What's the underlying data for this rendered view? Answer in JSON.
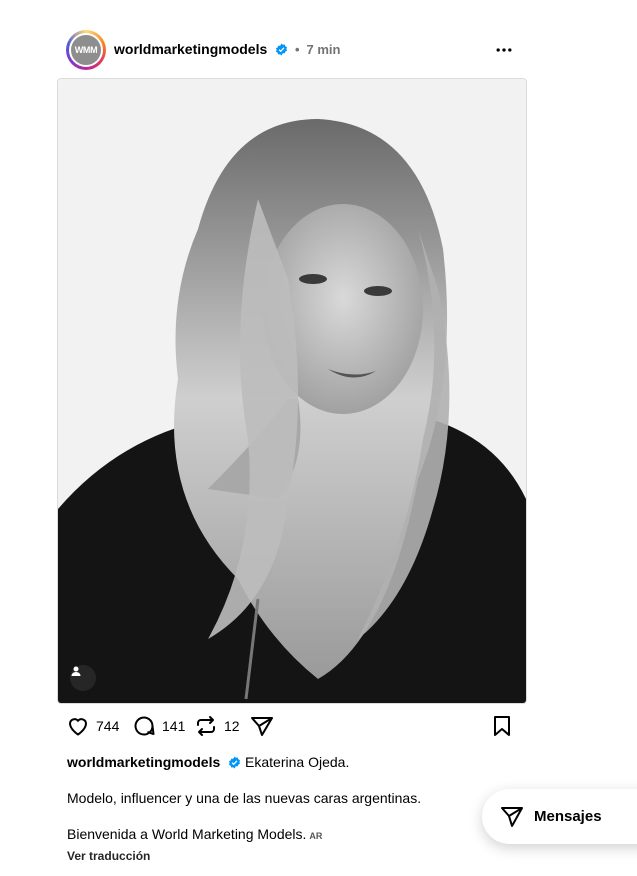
{
  "post": {
    "username": "worldmarketingmodels",
    "avatar_text": "WMM",
    "separator": "•",
    "time": "7 min",
    "verified": true
  },
  "actions": {
    "likes": "744",
    "comments": "141",
    "reposts": "12"
  },
  "caption": {
    "username": "worldmarketingmodels",
    "line1": "Ekaterina Ojeda.",
    "line2": "Modelo, influencer y una de las nuevas caras argentinas.",
    "line3": "Bienvenida a World Marketing Models.",
    "lang_badge": "AR",
    "translate": "Ver traducción"
  },
  "messages": {
    "label": "Mensajes"
  },
  "colors": {
    "verified": "#0095f6",
    "text": "#000000",
    "muted": "#737373"
  },
  "icons": [
    "heart-icon",
    "comment-icon",
    "repost-icon",
    "share-icon",
    "bookmark-icon",
    "more-icon",
    "user-tag-icon",
    "send-icon"
  ]
}
